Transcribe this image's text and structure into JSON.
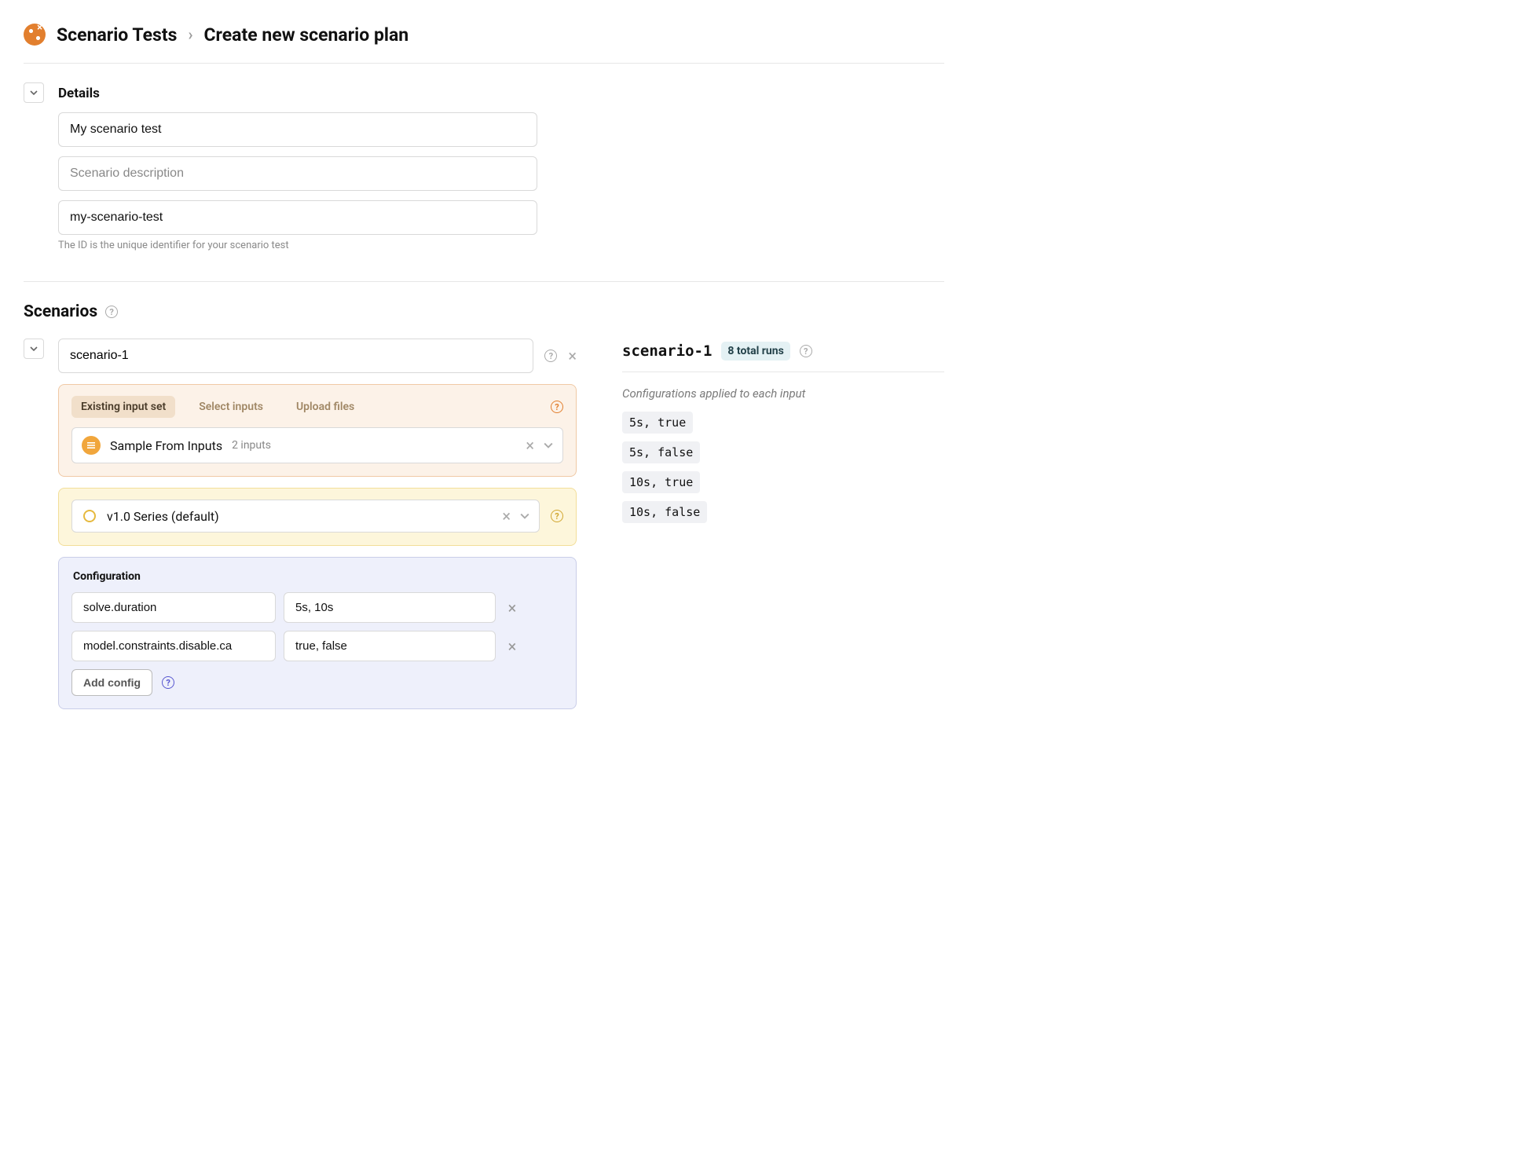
{
  "breadcrumb": {
    "root": "Scenario Tests",
    "current": "Create new scenario plan"
  },
  "details": {
    "heading": "Details",
    "name_value": "My scenario test",
    "description_placeholder": "Scenario description",
    "id_value": "my-scenario-test",
    "id_helper": "The ID is the unique identifier for your scenario test"
  },
  "scenarios_label": "Scenarios",
  "scenario": {
    "name": "scenario-1",
    "input_tabs": {
      "existing": "Existing input set",
      "select": "Select inputs",
      "upload": "Upload files"
    },
    "input_set": {
      "name": "Sample From Inputs",
      "meta": "2 inputs"
    },
    "series": {
      "name": "v1.0 Series (default)"
    },
    "config": {
      "heading": "Configuration",
      "rows": [
        {
          "key": "solve.duration",
          "val": "5s, 10s"
        },
        {
          "key": "model.constraints.disable.ca",
          "val": "true, false"
        }
      ],
      "add_label": "Add config"
    }
  },
  "summary": {
    "title": "scenario-1",
    "badge": "8 total runs",
    "subtitle": "Configurations applied to each input",
    "runs": [
      "5s, true",
      "5s, false",
      "10s, true",
      "10s, false"
    ]
  }
}
